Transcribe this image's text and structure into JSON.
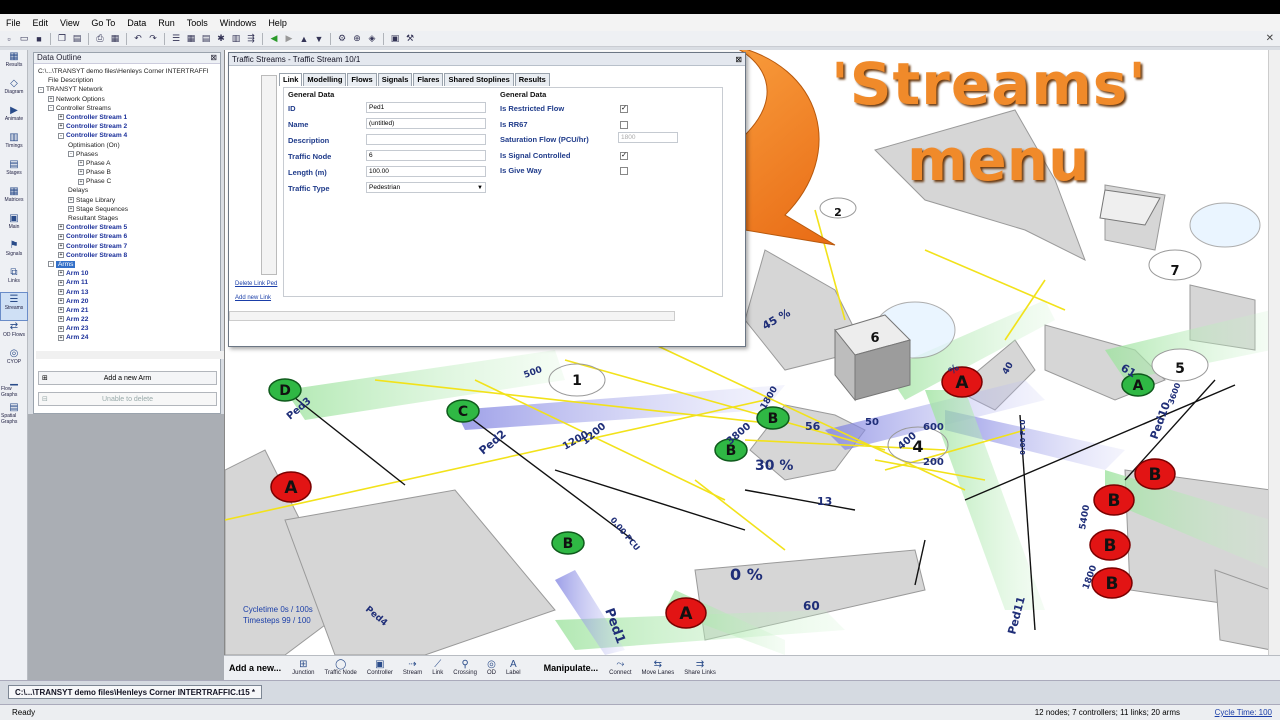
{
  "menu": [
    "File",
    "Edit",
    "View",
    "Go To",
    "Data",
    "Run",
    "Tools",
    "Windows",
    "Help"
  ],
  "left_strip": [
    "Results",
    "Diagram",
    "Animate",
    "Timings",
    "Stages",
    "Matrices",
    "Main",
    "Signals",
    "Links",
    "Streams",
    "OD Flows",
    "CYOP",
    "Flow Graphs",
    "Spatial Graphs"
  ],
  "outline": {
    "title": "Data Outline",
    "rows": [
      {
        "indent": 0,
        "text": "C:\\...\\TRANSYT demo files\\Henleys Corner INTERTRAFFIC",
        "style": "bl",
        "pm": ""
      },
      {
        "indent": 1,
        "text": "File Description",
        "style": "bl",
        "pm": ""
      },
      {
        "indent": 0,
        "text": "TRANSYT Network",
        "style": "bl",
        "pm": "-"
      },
      {
        "indent": 1,
        "text": "Network Options",
        "style": "bl",
        "pm": "+"
      },
      {
        "indent": 1,
        "text": "Controller Streams",
        "style": "bl",
        "pm": "-"
      },
      {
        "indent": 2,
        "text": "Controller Stream 1",
        "style": "b",
        "pm": "+"
      },
      {
        "indent": 2,
        "text": "Controller Stream 2",
        "style": "b",
        "pm": "+"
      },
      {
        "indent": 2,
        "text": "Controller Stream 4",
        "style": "b",
        "pm": "-"
      },
      {
        "indent": 3,
        "text": "Optimisation (On)",
        "style": "bl",
        "pm": ""
      },
      {
        "indent": 3,
        "text": "Phases",
        "style": "bl",
        "pm": "-"
      },
      {
        "indent": 4,
        "text": "Phase A",
        "style": "bl",
        "pm": "+"
      },
      {
        "indent": 4,
        "text": "Phase B",
        "style": "bl",
        "pm": "+"
      },
      {
        "indent": 4,
        "text": "Phase C",
        "style": "bl",
        "pm": "+"
      },
      {
        "indent": 3,
        "text": "Delays",
        "style": "bl",
        "pm": ""
      },
      {
        "indent": 3,
        "text": "Stage Library",
        "style": "bl",
        "pm": "+"
      },
      {
        "indent": 3,
        "text": "Stage Sequences",
        "style": "bl",
        "pm": "+"
      },
      {
        "indent": 3,
        "text": "Resultant Stages",
        "style": "bl",
        "pm": ""
      },
      {
        "indent": 2,
        "text": "Controller Stream 5",
        "style": "b",
        "pm": "+"
      },
      {
        "indent": 2,
        "text": "Controller Stream 6",
        "style": "b",
        "pm": "+"
      },
      {
        "indent": 2,
        "text": "Controller Stream 7",
        "style": "b",
        "pm": "+"
      },
      {
        "indent": 2,
        "text": "Controller Stream 8",
        "style": "b",
        "pm": "+"
      },
      {
        "indent": 1,
        "text": "Arms",
        "style": "sel",
        "pm": "-"
      },
      {
        "indent": 2,
        "text": "Arm 10",
        "style": "b",
        "pm": "+"
      },
      {
        "indent": 2,
        "text": "Arm 11",
        "style": "b",
        "pm": "+"
      },
      {
        "indent": 2,
        "text": "Arm 13",
        "style": "b",
        "pm": "+"
      },
      {
        "indent": 2,
        "text": "Arm 20",
        "style": "b",
        "pm": "+"
      },
      {
        "indent": 2,
        "text": "Arm 21",
        "style": "b",
        "pm": "+"
      },
      {
        "indent": 2,
        "text": "Arm 22",
        "style": "b",
        "pm": "+"
      },
      {
        "indent": 2,
        "text": "Arm 23",
        "style": "b",
        "pm": "+"
      },
      {
        "indent": 2,
        "text": "Arm 24",
        "style": "b",
        "pm": "+"
      }
    ],
    "add_arm": "Add a new Arm",
    "unable_delete": "Unable to delete"
  },
  "stream_window": {
    "title": "Traffic Streams - Traffic Stream 10/1",
    "tabs": [
      "Link",
      "Modelling",
      "Flows",
      "Signals",
      "Flares",
      "Shared Stoplines",
      "Results"
    ],
    "general_left": "General Data",
    "general_right": "General Data",
    "fields": {
      "id_label": "ID",
      "id_value": "Ped1",
      "name_label": "Name",
      "name_value": "(untitled)",
      "desc_label": "Description",
      "desc_value": "",
      "node_label": "Traffic Node",
      "node_value": "6",
      "length_label": "Length (m)",
      "length_value": "100.00",
      "type_label": "Traffic Type",
      "type_value": "Pedestrian"
    },
    "right_fields": [
      "Is Restricted Flow",
      "Is RR67",
      "Saturation Flow (PCU/hr)",
      "Is Signal Controlled",
      "Is Give Way"
    ],
    "sat_value": "1800",
    "delete_link": "Delete Link Ped",
    "add_link": "Add new Link"
  },
  "canvas": {
    "cycletime": "Cycletime 0s / 100s",
    "timesteps": "Timesteps 99 / 100",
    "headline_line1": "'Streams'",
    "headline_line2": "menu",
    "nodes": [
      "1",
      "2",
      "4",
      "5",
      "6",
      "7"
    ],
    "signals": [
      {
        "label": "A",
        "color": "red"
      },
      {
        "label": "A",
        "color": "red"
      },
      {
        "label": "A",
        "color": "red"
      },
      {
        "label": "B",
        "color": "red"
      },
      {
        "label": "B",
        "color": "red"
      },
      {
        "label": "B",
        "color": "red"
      },
      {
        "label": "B",
        "color": "red"
      },
      {
        "label": "B",
        "color": "green"
      },
      {
        "label": "B",
        "color": "green"
      },
      {
        "label": "B",
        "color": "green"
      },
      {
        "label": "C",
        "color": "green"
      },
      {
        "label": "D",
        "color": "green"
      },
      {
        "label": "A",
        "color": "green"
      }
    ],
    "labels": [
      "Ped1",
      "Ped2",
      "Ped3",
      "Ped10",
      "Ped11",
      "Ped4",
      "1200",
      "1800",
      "3800",
      "500",
      "40",
      "56",
      "30 %",
      "0 %",
      "45 %",
      "%",
      "61",
      "60",
      "13",
      "200",
      "400",
      "600",
      "50",
      "0.00 PCU",
      "1200",
      "3600",
      "0.00 PCU",
      "1800",
      "5400"
    ]
  },
  "bottom_toolbar": {
    "add_new": "Add a new...",
    "items": [
      "Junction",
      "Traffic Node",
      "Controller",
      "Stream",
      "Link",
      "Crossing",
      "OD",
      "Label"
    ],
    "manipulate": "Manipulate...",
    "manip_items": [
      "Connect",
      "Move Lanes",
      "Share Links"
    ]
  },
  "file_tab": "C:\\...\\TRANSYT demo files\\Henleys Corner INTERTRAFFIC.t15 *",
  "status": {
    "ready": "Ready",
    "stats": "12 nodes; 7 controllers; 11 links; 20 arms",
    "cycle_time": "Cycle Time: 100"
  },
  "colors": {
    "accent_orange": "#f08a2a",
    "signal_red": "#e21414",
    "signal_green": "#2fb844",
    "link_yellow": "#f2e21a"
  }
}
